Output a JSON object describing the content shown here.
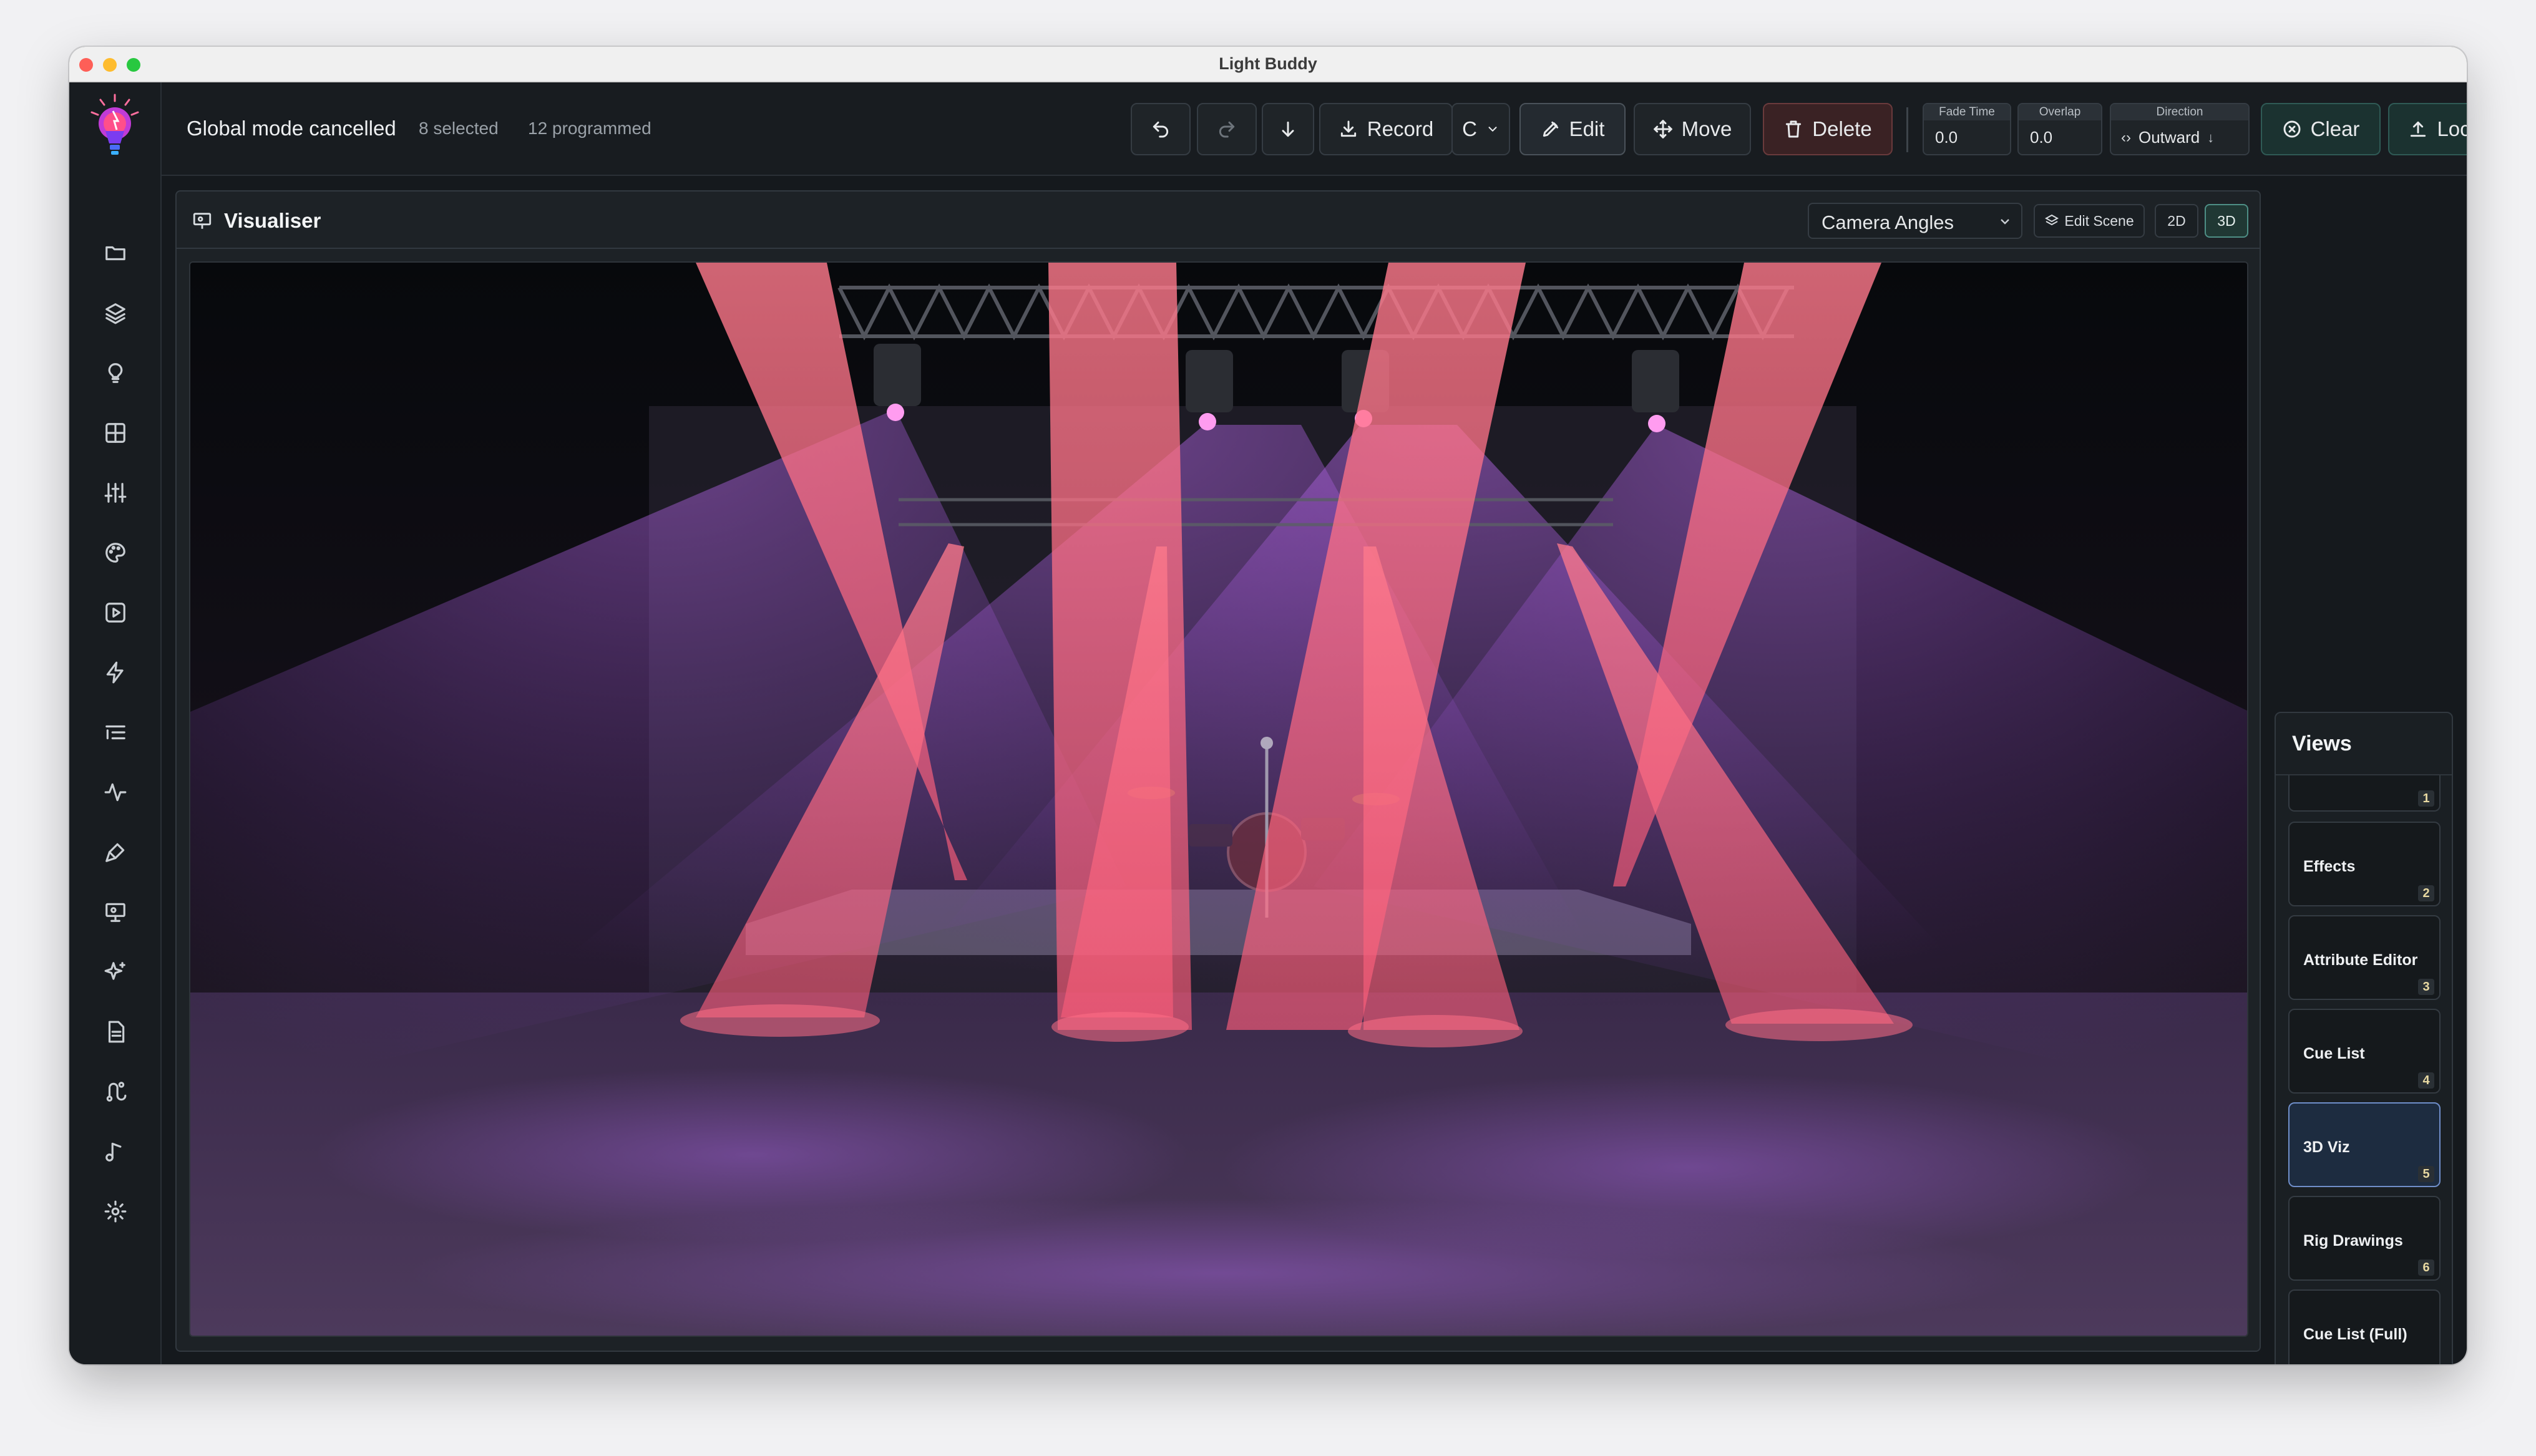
{
  "window": {
    "title": "Light Buddy"
  },
  "status": {
    "message": "Global mode cancelled",
    "selected": "8 selected",
    "programmed": "12 programmed"
  },
  "toolbar": {
    "record_label": "Record",
    "cue_label": "C",
    "edit_label": "Edit",
    "move_label": "Move",
    "delete_label": "Delete",
    "clear_label": "Clear",
    "locate_label": "Locate",
    "fade_time": {
      "label": "Fade Time",
      "value": "0.0"
    },
    "overlap": {
      "label": "Overlap",
      "value": "0.0"
    },
    "direction": {
      "label": "Direction",
      "value": "Outward"
    }
  },
  "sidebar": {
    "icons": [
      "folder-icon",
      "layers-icon",
      "lightbulb-icon",
      "grid-icon",
      "sliders-icon",
      "palette-icon",
      "play-square-icon",
      "lightning-icon",
      "list-indent-icon",
      "activity-icon",
      "brush-icon",
      "presentation-icon",
      "sparkles-icon",
      "document-icon",
      "routing-icon",
      "music-note-icon",
      "settings-gear-icon"
    ]
  },
  "visualiser": {
    "title": "Visualiser",
    "camera_select": "Camera Angles",
    "edit_scene_label": "Edit Scene",
    "mode_2d": "2D",
    "mode_3d": "3D",
    "active_mode": "3D"
  },
  "views": {
    "title": "Views",
    "items": [
      {
        "label": "",
        "num": "1"
      },
      {
        "label": "Effects",
        "num": "2"
      },
      {
        "label": "Attribute Editor",
        "num": "3"
      },
      {
        "label": "Cue List",
        "num": "4"
      },
      {
        "label": "3D Viz",
        "num": "5",
        "active": true
      },
      {
        "label": "Rig Drawings",
        "num": "6"
      },
      {
        "label": "Cue List (Full)",
        "num": ""
      }
    ]
  },
  "colors": {
    "beam_pink": "#ff6f86",
    "wash_purple": "#8a4db8",
    "accent_green": "#4e8f86",
    "active_blue": "#6f8ec9"
  }
}
